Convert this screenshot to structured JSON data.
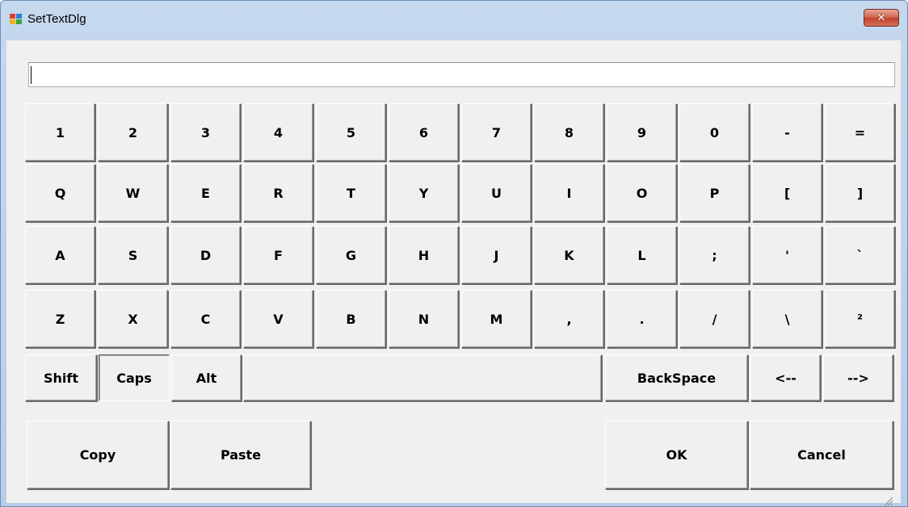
{
  "window": {
    "title": "SetTextDlg",
    "close_symbol": "✕",
    "icon": "app-window-icon"
  },
  "input": {
    "value": "",
    "placeholder": ""
  },
  "keyboard": {
    "row1": [
      "1",
      "2",
      "3",
      "4",
      "5",
      "6",
      "7",
      "8",
      "9",
      "0",
      "-",
      "="
    ],
    "row2": [
      "Q",
      "W",
      "E",
      "R",
      "T",
      "Y",
      "U",
      "I",
      "O",
      "P",
      "[",
      "]"
    ],
    "row3": [
      "A",
      "S",
      "D",
      "F",
      "G",
      "H",
      "J",
      "K",
      "L",
      ";",
      "'",
      "`"
    ],
    "row4": [
      "Z",
      "X",
      "C",
      "V",
      "B",
      "N",
      "M",
      ",",
      ".",
      "/",
      "\\",
      "²"
    ],
    "row5": {
      "shift": "Shift",
      "caps": "Caps",
      "alt": "Alt",
      "space": "",
      "backspace": "BackSpace",
      "left": "<--",
      "right": "-->"
    }
  },
  "actions": {
    "copy": "Copy",
    "paste": "Paste",
    "ok": "OK",
    "cancel": "Cancel"
  },
  "state": {
    "caps_pressed": true
  },
  "colors": {
    "titlebar": "#c5d8ee",
    "client": "#f0f0f0",
    "close_button": "#c0432b"
  }
}
